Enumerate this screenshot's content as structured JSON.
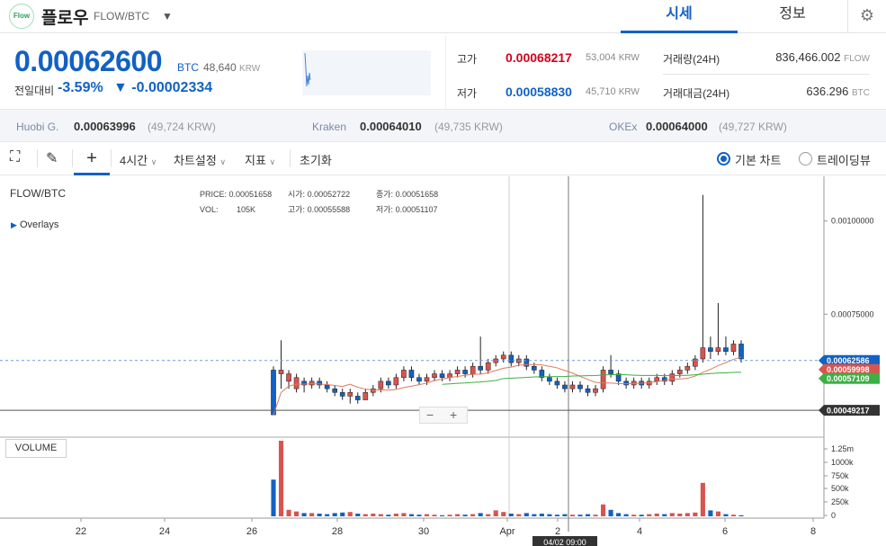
{
  "header": {
    "logo_text": "Flow",
    "coin_name": "플로우",
    "pair": "FLOW/BTC",
    "tabs": [
      "시세",
      "정보"
    ]
  },
  "price": {
    "current": "0.00062600",
    "unit": "BTC",
    "krw": "48,640",
    "krw_unit": "KRW",
    "change_label": "전일대비",
    "change_pct": "-3.59%",
    "change_amt": "▼ -0.00002334"
  },
  "stats": {
    "high_label": "고가",
    "high_value": "0.00068217",
    "high_krw": "53,004",
    "high_krw_unit": "KRW",
    "low_label": "저가",
    "low_value": "0.00058830",
    "low_krw": "45,710",
    "low_krw_unit": "KRW",
    "volume_label": "거래량(24H)",
    "volume_value": "836,466.002",
    "volume_unit": "FLOW",
    "amount_label": "거래대금(24H)",
    "amount_value": "636.296",
    "amount_unit": "BTC"
  },
  "exchanges": [
    {
      "name": "Huobi G.",
      "value": "0.00063996",
      "krw": "(49,724 KRW)"
    },
    {
      "name": "Kraken",
      "value": "0.00064010",
      "krw": "(49,735 KRW)"
    },
    {
      "name": "OKEx",
      "value": "0.00064000",
      "krw": "(49,727 KRW)"
    }
  ],
  "toolbar": {
    "interval": "4시간",
    "chart_settings": "차트설정",
    "indicators": "지표",
    "reset": "초기화",
    "basic_chart": "기본 차트",
    "tradingview": "트레이딩뷰"
  },
  "chart_data": {
    "type": "candlestick",
    "pair_label": "FLOW/BTC",
    "overlays_label": "Overlays",
    "legend": {
      "price_label": "PRICE:",
      "price": "0.00051658",
      "open_label": "시가:",
      "open": "0.00052722",
      "close_label": "종가:",
      "close": "0.00051658",
      "vol_label": "VOL:",
      "vol": "105K",
      "high_label": "고가:",
      "high": "0.00055588",
      "low_label": "저가:",
      "low": "0.00051107"
    },
    "y_ticks": [
      "0.00100000",
      "0.00075000"
    ],
    "y_tick_values": [
      0.001,
      0.00075
    ],
    "price_tags": [
      {
        "value": "0.00062586",
        "color": "#1261c4"
      },
      {
        "value": "0.00059998",
        "color": "#d9534f"
      },
      {
        "value": "0.00057109",
        "color": "#3cb043"
      },
      {
        "value": "0.00049217",
        "color": "#333333"
      }
    ],
    "volume_label": "VOLUME",
    "volume_ticks": [
      "1.25m",
      "1000k",
      "750k",
      "500k",
      "250k",
      "0"
    ],
    "x_ticks": [
      "22",
      "24",
      "26",
      "28",
      "30",
      "Apr",
      "2",
      "4",
      "6",
      "8"
    ],
    "crosshair_label": "04/02 09:00",
    "ylim": [
      0.00042,
      0.00112
    ],
    "candles": [
      [
        0.0006,
        0.00048,
        0.00061,
        0.00048,
        680
      ],
      [
        0.00059,
        0.0006,
        0.00068,
        0.00055,
        1400
      ],
      [
        0.00057,
        0.00059,
        0.0006,
        0.00055,
        120
      ],
      [
        0.00055,
        0.00058,
        0.00059,
        0.00054,
        90
      ],
      [
        0.00057,
        0.00056,
        0.00058,
        0.00054,
        60
      ],
      [
        0.00056,
        0.00057,
        0.00058,
        0.00055,
        60
      ],
      [
        0.00057,
        0.00056,
        0.00058,
        0.00055,
        50
      ],
      [
        0.00056,
        0.00055,
        0.00057,
        0.00054,
        40
      ],
      [
        0.00055,
        0.00054,
        0.00056,
        0.00053,
        60
      ],
      [
        0.00054,
        0.00053,
        0.00055,
        0.00052,
        70
      ],
      [
        0.00053,
        0.00054,
        0.00055,
        0.00051,
        80
      ],
      [
        0.00053,
        0.00052,
        0.00054,
        0.00051,
        50
      ],
      [
        0.00052,
        0.00054,
        0.00055,
        0.00052,
        40
      ],
      [
        0.00054,
        0.00055,
        0.00056,
        0.00053,
        50
      ],
      [
        0.00055,
        0.00057,
        0.00058,
        0.00054,
        40
      ],
      [
        0.00057,
        0.00056,
        0.00058,
        0.00055,
        30
      ],
      [
        0.00056,
        0.00058,
        0.00059,
        0.00055,
        50
      ],
      [
        0.00058,
        0.0006,
        0.00061,
        0.00057,
        60
      ],
      [
        0.0006,
        0.00058,
        0.00061,
        0.00057,
        40
      ],
      [
        0.00058,
        0.00057,
        0.00059,
        0.00056,
        30
      ],
      [
        0.00057,
        0.00058,
        0.00059,
        0.00056,
        40
      ],
      [
        0.00058,
        0.00059,
        0.0006,
        0.00057,
        30
      ],
      [
        0.00059,
        0.00058,
        0.0006,
        0.00057,
        20
      ],
      [
        0.00058,
        0.00059,
        0.0006,
        0.00057,
        30
      ],
      [
        0.00059,
        0.0006,
        0.00061,
        0.00058,
        40
      ],
      [
        0.0006,
        0.00059,
        0.00061,
        0.00058,
        30
      ],
      [
        0.00059,
        0.00061,
        0.00062,
        0.00058,
        40
      ],
      [
        0.00061,
        0.0006,
        0.00069,
        0.00059,
        60
      ],
      [
        0.0006,
        0.00062,
        0.00063,
        0.00059,
        40
      ],
      [
        0.00062,
        0.00063,
        0.00064,
        0.00061,
        110
      ],
      [
        0.00063,
        0.00064,
        0.00065,
        0.00062,
        80
      ],
      [
        0.00064,
        0.00062,
        0.00065,
        0.00061,
        50
      ],
      [
        0.00062,
        0.00063,
        0.00064,
        0.00061,
        40
      ],
      [
        0.00063,
        0.00061,
        0.00064,
        0.0006,
        60
      ],
      [
        0.00061,
        0.0006,
        0.00062,
        0.00059,
        40
      ],
      [
        0.0006,
        0.00058,
        0.00061,
        0.00057,
        50
      ],
      [
        0.00058,
        0.00057,
        0.00059,
        0.00056,
        40
      ],
      [
        0.00057,
        0.00056,
        0.00058,
        0.00055,
        30
      ],
      [
        0.00056,
        0.00055,
        0.00057,
        0.00054,
        40
      ],
      [
        0.00055,
        0.00056,
        0.00057,
        0.00054,
        30
      ],
      [
        0.00056,
        0.00055,
        0.00057,
        0.00054,
        30
      ],
      [
        0.00055,
        0.00054,
        0.00056,
        0.00053,
        40
      ],
      [
        0.00054,
        0.00055,
        0.00056,
        0.00053,
        30
      ],
      [
        0.00055,
        0.0006,
        0.00061,
        0.00054,
        220
      ],
      [
        0.0006,
        0.00059,
        0.00064,
        0.00058,
        120
      ],
      [
        0.00059,
        0.00057,
        0.0006,
        0.00056,
        60
      ],
      [
        0.00057,
        0.00056,
        0.00058,
        0.00055,
        40
      ],
      [
        0.00056,
        0.00057,
        0.00058,
        0.00055,
        30
      ],
      [
        0.00057,
        0.00056,
        0.00058,
        0.00055,
        30
      ],
      [
        0.00056,
        0.00057,
        0.00058,
        0.00055,
        40
      ],
      [
        0.00057,
        0.00058,
        0.00059,
        0.00056,
        50
      ],
      [
        0.00058,
        0.00057,
        0.00059,
        0.00056,
        40
      ],
      [
        0.00057,
        0.00059,
        0.0006,
        0.00056,
        60
      ],
      [
        0.00059,
        0.0006,
        0.00061,
        0.00058,
        50
      ],
      [
        0.0006,
        0.00061,
        0.00062,
        0.00059,
        60
      ],
      [
        0.00061,
        0.00063,
        0.00064,
        0.0006,
        70
      ],
      [
        0.00063,
        0.00066,
        0.00107,
        0.00062,
        620
      ],
      [
        0.00066,
        0.00065,
        0.00069,
        0.00063,
        110
      ],
      [
        0.00065,
        0.00066,
        0.00078,
        0.00064,
        90
      ],
      [
        0.00066,
        0.00065,
        0.00069,
        0.00064,
        40
      ],
      [
        0.00065,
        0.00067,
        0.00068,
        0.00064,
        30
      ],
      [
        0.00067,
        0.00063,
        0.00068,
        0.00062,
        20
      ]
    ]
  }
}
